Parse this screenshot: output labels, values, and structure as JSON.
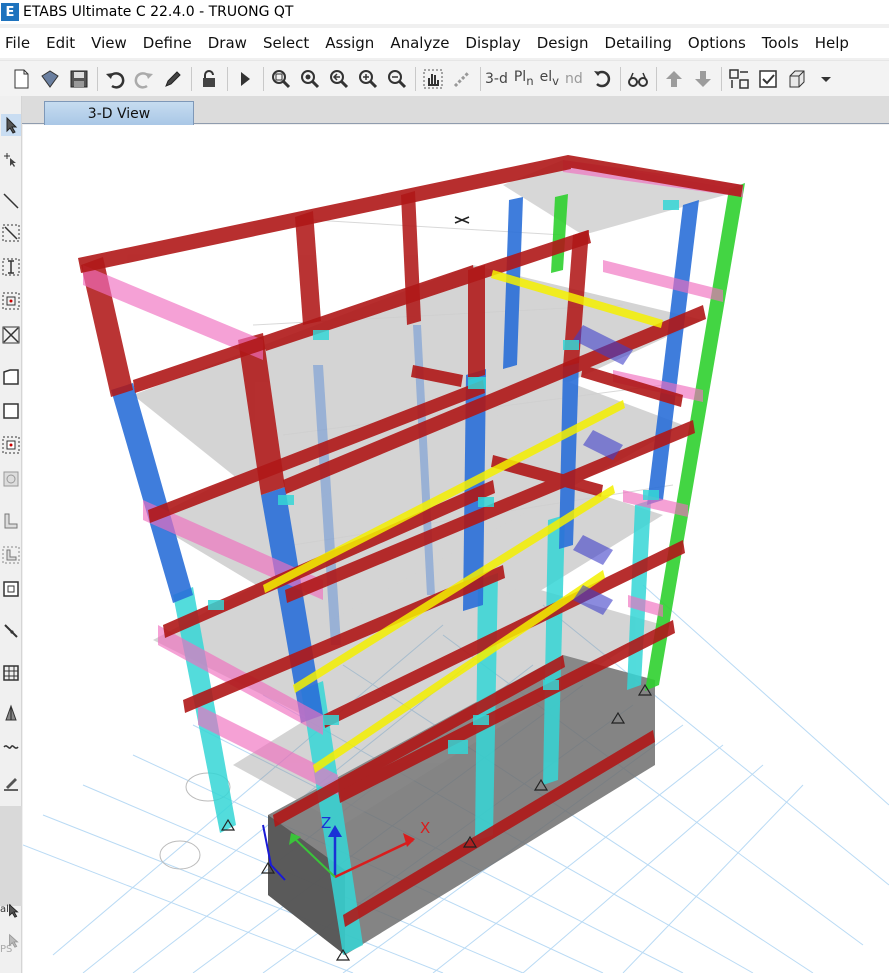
{
  "window": {
    "logo_letter": "E",
    "title": "ETABS Ultimate C 22.4.0 - TRUONG QT"
  },
  "menu": [
    "File",
    "Edit",
    "View",
    "Define",
    "Draw",
    "Select",
    "Assign",
    "Analyze",
    "Display",
    "Design",
    "Detailing",
    "Options",
    "Tools",
    "Help"
  ],
  "toolbar": {
    "view_3d_label": "3-d",
    "plan_label": "Pl",
    "plan_sub": "n",
    "elev_label": "el",
    "elev_sub": "v",
    "nd_label": "nd"
  },
  "tabs": {
    "active": "3-D View"
  },
  "left_tools": {
    "bottom_label_1": "all",
    "bottom_label_2": "PS"
  },
  "axes": {
    "x_label": "X",
    "z_label": "Z"
  },
  "colors": {
    "beam_red": "#b01818",
    "column_blue": "#2a6fd8",
    "column_cyan": "#35d6d6",
    "column_green": "#2fd02f",
    "beam_pink": "#f06fc0",
    "beam_yellow": "#f4f000",
    "slab_gray": "#7a7a7a",
    "grid_blue": "#8fc3ee",
    "tab_active": "#b8d3ee"
  }
}
